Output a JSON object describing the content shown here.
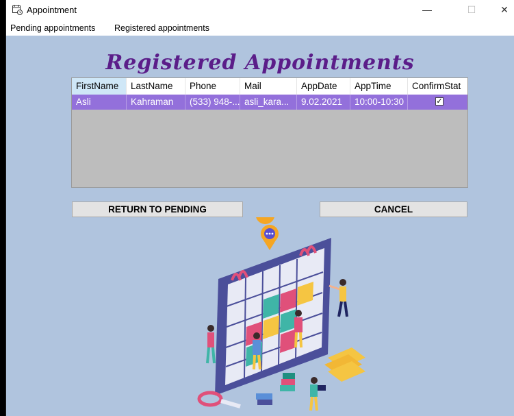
{
  "window": {
    "title": "Appointment",
    "minimize": "—",
    "maximize": "☐",
    "close": "✕"
  },
  "menu": {
    "items": [
      "Pending appointments",
      "Registered appointments"
    ]
  },
  "heading": "Registered Appointments",
  "grid": {
    "columns": [
      "FirstName",
      "LastName",
      "Phone",
      "Mail",
      "AppDate",
      "AppTime",
      "ConfirmStat"
    ],
    "rows": [
      {
        "first_name": "Asli",
        "last_name": "Kahraman",
        "phone": "(533) 948-...",
        "mail": "asli_kara...",
        "app_date": "9.02.2021",
        "app_time": "10:00-10:30",
        "confirmed": true
      }
    ]
  },
  "buttons": {
    "return": "RETURN TO PENDING",
    "cancel": "CANCEL"
  },
  "colors": {
    "background": "#b0c4de",
    "heading": "#5b1d89",
    "selected_row": "#9370db",
    "grid_empty": "#bdbdbd"
  },
  "icons": [
    "calendar-app-icon",
    "minimize-icon",
    "maximize-icon",
    "close-icon",
    "checkbox-checked-icon",
    "calendar-illustration"
  ]
}
